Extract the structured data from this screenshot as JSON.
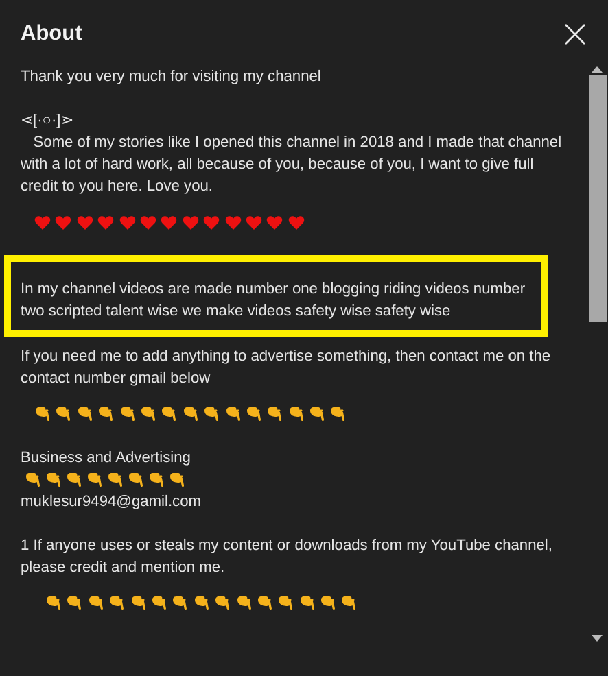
{
  "dialog": {
    "title": "About"
  },
  "blocks": [
    {
      "kind": "text",
      "text": "Thank you very much for visiting my channel"
    },
    {
      "kind": "text",
      "text": "⋖[·○·]⋗\n   Some of my stories like I opened this channel in 2018 and I made that channel with a lot of hard work, all because of you, because of you, I want to give full credit to you here. Love you."
    },
    {
      "kind": "icons",
      "icons": [
        {
          "kind": "heart"
        },
        {
          "kind": "heart"
        },
        {
          "kind": "heart"
        },
        {
          "kind": "heart"
        },
        {
          "kind": "heart"
        },
        {
          "kind": "heart"
        },
        {
          "kind": "heart"
        },
        {
          "kind": "heart"
        },
        {
          "kind": "heart"
        },
        {
          "kind": "heart"
        },
        {
          "kind": "heart"
        },
        {
          "kind": "heart"
        },
        {
          "kind": "heart"
        }
      ]
    },
    {
      "kind": "highlight",
      "text": "In my channel videos are made number one blogging riding videos number two scripted talent wise we make videos safety wise safety wise"
    },
    {
      "kind": "text",
      "text": "If you need me to add anything to advertise something, then contact me on the contact number gmail below"
    },
    {
      "kind": "icons",
      "icons": [
        {
          "kind": "hand"
        },
        {
          "kind": "hand"
        },
        {
          "kind": "hand"
        },
        {
          "kind": "hand"
        },
        {
          "kind": "hand"
        },
        {
          "kind": "hand"
        },
        {
          "kind": "hand"
        },
        {
          "kind": "hand"
        },
        {
          "kind": "hand"
        },
        {
          "kind": "hand"
        },
        {
          "kind": "hand"
        },
        {
          "kind": "hand"
        },
        {
          "kind": "hand"
        },
        {
          "kind": "hand"
        },
        {
          "kind": "hand"
        }
      ]
    },
    {
      "kind": "contact",
      "label": "Business and Advertising",
      "icons": [
        {
          "kind": "hand"
        },
        {
          "kind": "hand"
        },
        {
          "kind": "hand"
        },
        {
          "kind": "hand"
        },
        {
          "kind": "hand"
        },
        {
          "kind": "hand"
        },
        {
          "kind": "hand"
        },
        {
          "kind": "hand"
        }
      ],
      "email": "muklesur9494@gamil.com"
    },
    {
      "kind": "text",
      "text": "1 If anyone uses or steals my content or downloads from my YouTube channel, please credit and mention me."
    },
    {
      "kind": "icons",
      "indent": true,
      "icons": [
        {
          "kind": "hand"
        },
        {
          "kind": "hand"
        },
        {
          "kind": "hand"
        },
        {
          "kind": "hand"
        },
        {
          "kind": "hand"
        },
        {
          "kind": "hand"
        },
        {
          "kind": "hand"
        },
        {
          "kind": "hand"
        },
        {
          "kind": "hand"
        },
        {
          "kind": "hand"
        },
        {
          "kind": "hand"
        },
        {
          "kind": "hand"
        },
        {
          "kind": "hand"
        },
        {
          "kind": "hand"
        },
        {
          "kind": "hand"
        }
      ]
    }
  ]
}
